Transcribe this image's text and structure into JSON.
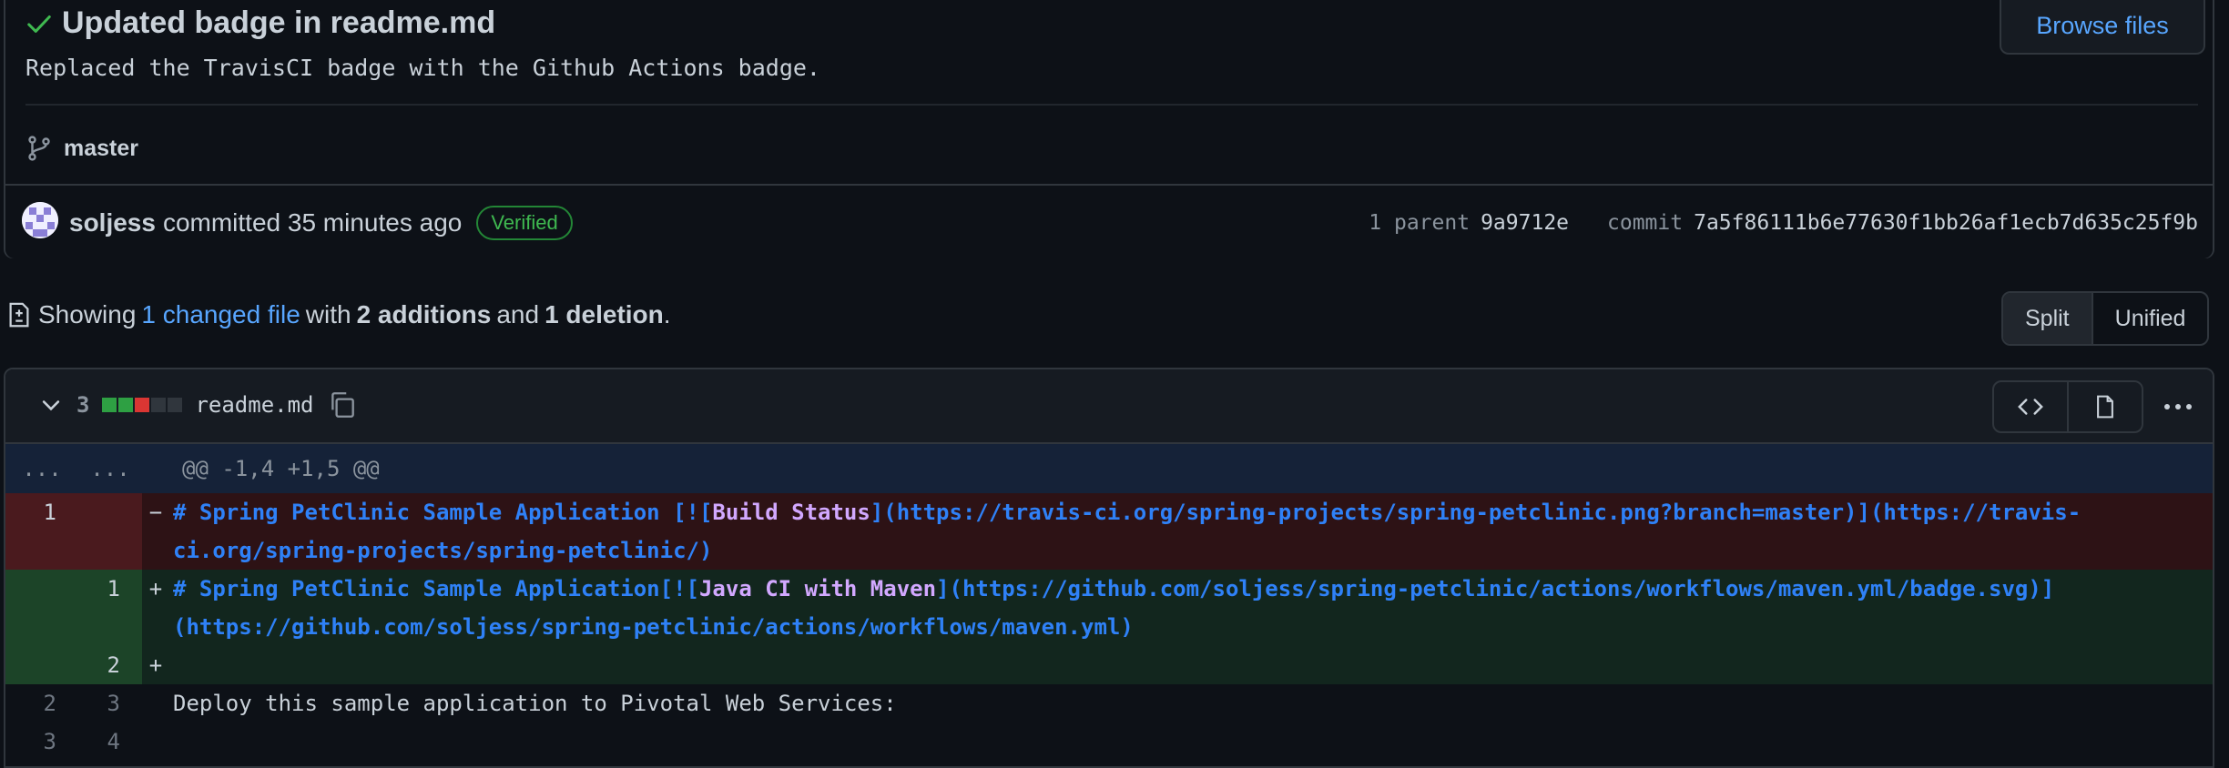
{
  "commit": {
    "title": "Updated badge in readme.md",
    "description": "Replaced the TravisCI badge with the Github Actions badge.",
    "browse_label": "Browse files",
    "branch": "master",
    "author": "soljess",
    "action": "committed 35 minutes ago",
    "verified": "Verified",
    "parent_label": "1 parent",
    "parent_sha": "9a9712e",
    "commit_label": "commit",
    "commit_sha": "7a5f86111b6e77630f1bb26af1ecb7d635c25f9b"
  },
  "summary": {
    "showing": "Showing",
    "changed_files": "1 changed file",
    "with": "with",
    "additions": "2 additions",
    "and": "and",
    "deletions": "1 deletion",
    "period": "."
  },
  "view_toggle": {
    "split": "Split",
    "unified": "Unified"
  },
  "file": {
    "changes": "3",
    "name": "readme.md",
    "diffstat_colors": [
      "#2ea043",
      "#2ea043",
      "#da3633",
      "#30363d",
      "#30363d"
    ]
  },
  "diff": {
    "hunk_old": "...",
    "hunk_new": "...",
    "hunk_header": "@@ -1,4 +1,5 @@",
    "del_line_no": "1",
    "del_marker": "−",
    "del_prefix": "# Spring PetClinic Sample Application [![",
    "del_badge": "Build Status",
    "del_suffix": "](https://travis-ci.org/spring-projects/spring-petclinic.png?branch=master)](https://travis-ci.org/spring-projects/spring-petclinic/)",
    "add1_line_no": "1",
    "add1_marker": "+",
    "add1_prefix": "# Spring PetClinic Sample Application[![",
    "add1_badge": "Java CI with Maven",
    "add1_suffix": "](https://github.com/soljess/spring-petclinic/actions/workflows/maven.yml/badge.svg)](https://github.com/soljess/spring-petclinic/actions/workflows/maven.yml)",
    "add2_line_no": "2",
    "add2_marker": "+",
    "ctx1_old": "2",
    "ctx1_new": "3",
    "ctx1_code": "Deploy this sample application to Pivotal Web Services:",
    "ctx2_old": "3",
    "ctx2_new": "4"
  }
}
